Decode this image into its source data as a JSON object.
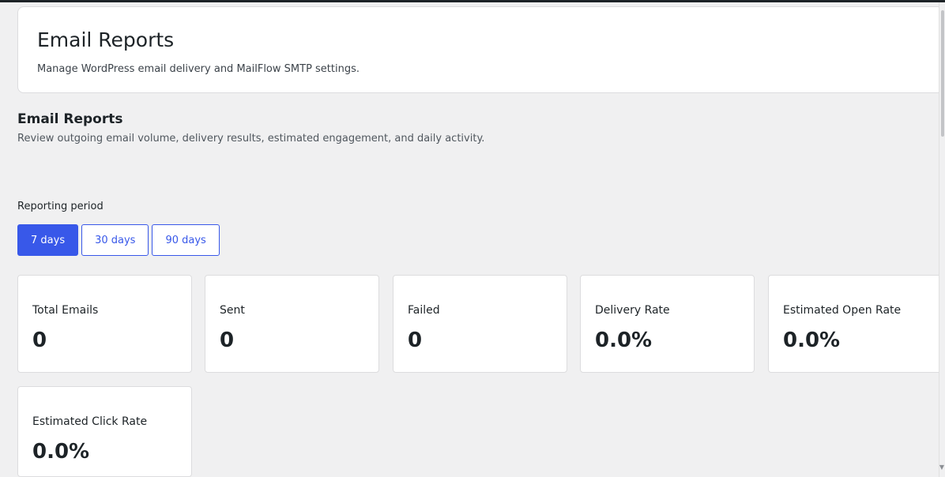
{
  "header": {
    "title": "Email Reports",
    "subtitle": "Manage WordPress email delivery and MailFlow SMTP settings."
  },
  "section": {
    "title": "Email Reports",
    "description": "Review outgoing email volume, delivery results, estimated engagement, and daily activity."
  },
  "period": {
    "label": "Reporting period",
    "options": [
      {
        "label": "7 days",
        "active": true
      },
      {
        "label": "30 days",
        "active": false
      },
      {
        "label": "90 days",
        "active": false
      }
    ]
  },
  "stats": [
    {
      "label": "Total Emails",
      "value": "0"
    },
    {
      "label": "Sent",
      "value": "0"
    },
    {
      "label": "Failed",
      "value": "0"
    },
    {
      "label": "Delivery Rate",
      "value": "0.0%"
    },
    {
      "label": "Estimated Open Rate",
      "value": "0.0%"
    },
    {
      "label": "Estimated Click Rate",
      "value": "0.0%"
    }
  ],
  "colors": {
    "accent": "#3858e9",
    "background": "#f0f0f1",
    "card": "#ffffff",
    "text": "#1d2327"
  }
}
